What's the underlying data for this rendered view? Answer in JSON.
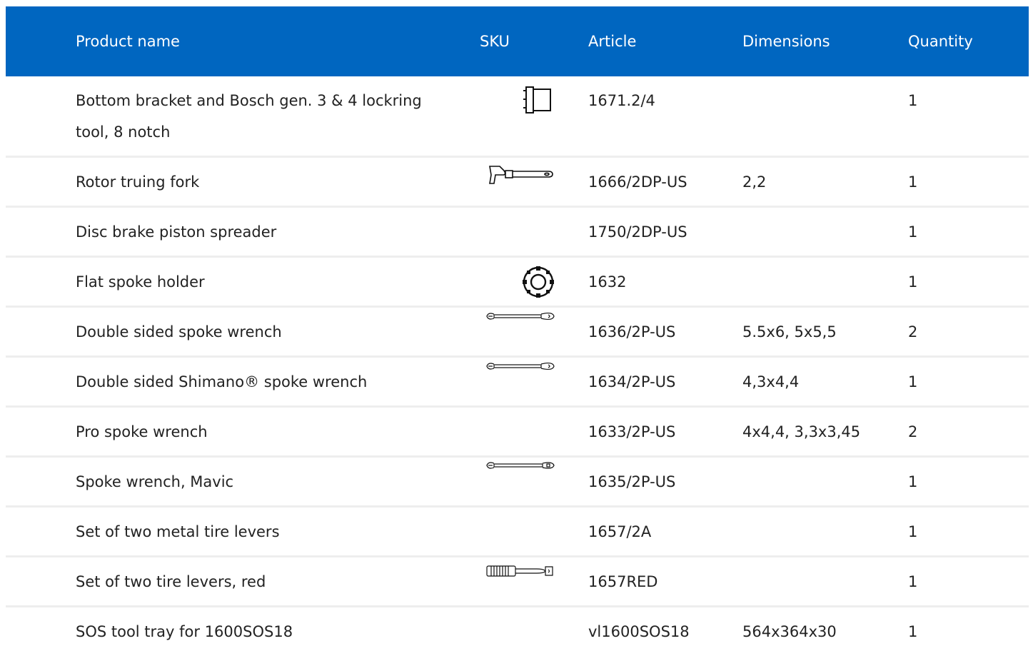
{
  "table": {
    "header": {
      "product_name": "Product name",
      "sku": "SKU",
      "article": "Article",
      "dimensions": "Dimensions",
      "quantity": "Quantity"
    },
    "rows": [
      {
        "name": "Bottom bracket and Bosch gen. 3 & 4 lockring tool, 8 notch",
        "icon": "lockring-tool-icon",
        "article": "1671.2/4",
        "dimensions": "",
        "quantity": "1"
      },
      {
        "name": "Rotor truing fork",
        "icon": "rotor-truing-fork-icon",
        "article": "1666/2DP-US",
        "dimensions": "2,2",
        "quantity": "1"
      },
      {
        "name": "Disc brake piston spreader",
        "icon": "",
        "article": "1750/2DP-US",
        "dimensions": "",
        "quantity": "1"
      },
      {
        "name": "Flat spoke holder",
        "icon": "spoke-holder-icon",
        "article": "1632",
        "dimensions": "",
        "quantity": "1"
      },
      {
        "name": "Double sided spoke wrench",
        "icon": "spoke-wrench-icon",
        "article": "1636/2P-US",
        "dimensions": "5.5x6, 5x5,5",
        "quantity": "2"
      },
      {
        "name": "Double sided Shimano® spoke wrench",
        "icon": "spoke-wrench-icon",
        "article": "1634/2P-US",
        "dimensions": "4,3x4,4",
        "quantity": "1"
      },
      {
        "name": "Pro spoke wrench",
        "icon": "",
        "article": "1633/2P-US",
        "dimensions": "4x4,4, 3,3x3,45",
        "quantity": "2"
      },
      {
        "name": "Spoke wrench, Mavic",
        "icon": "mavic-spoke-wrench-icon",
        "article": "1635/2P-US",
        "dimensions": "",
        "quantity": "1"
      },
      {
        "name": "Set of two metal tire levers",
        "icon": "",
        "article": "1657/2A",
        "dimensions": "",
        "quantity": "1"
      },
      {
        "name": "Set of two tire levers, red",
        "icon": "tire-lever-icon",
        "article": "1657RED",
        "dimensions": "",
        "quantity": "1"
      },
      {
        "name": "SOS tool tray for 1600SOS18",
        "icon": "",
        "article": "vl1600SOS18",
        "dimensions": "564x364x30",
        "quantity": "1"
      }
    ]
  }
}
